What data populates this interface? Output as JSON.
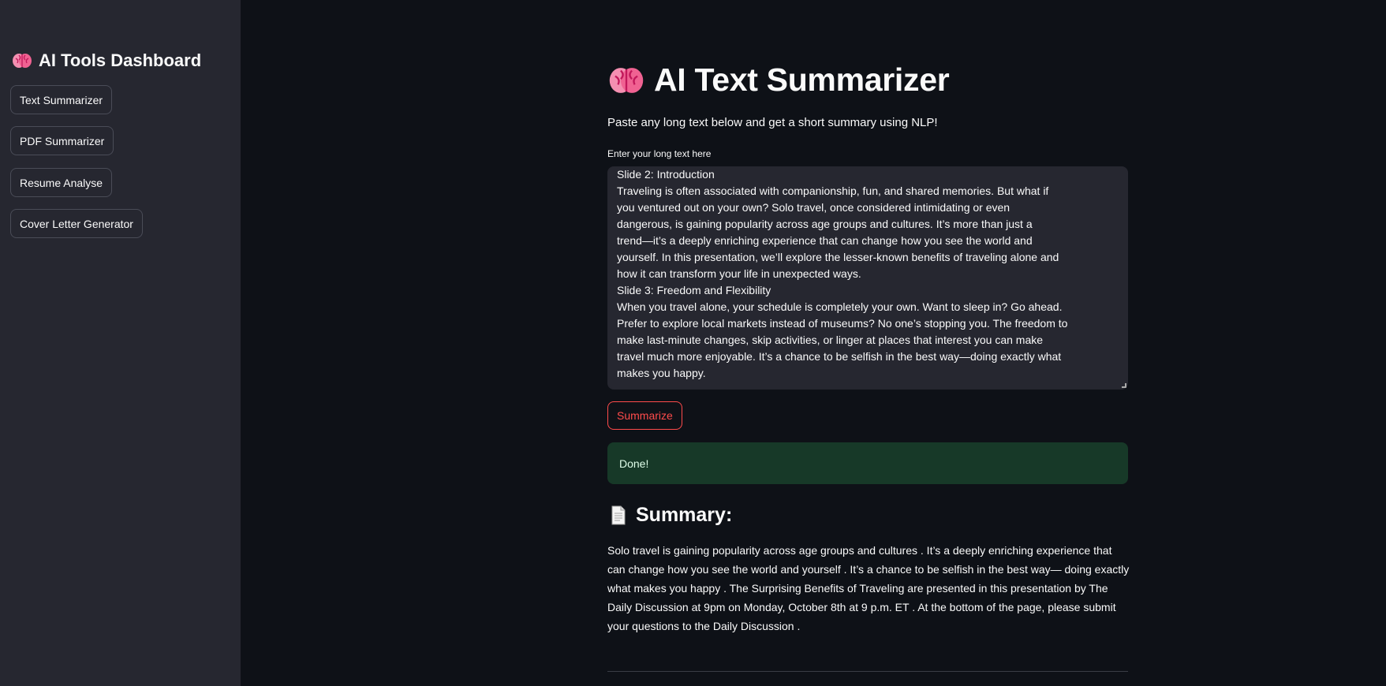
{
  "sidebar": {
    "title": "AI Tools Dashboard",
    "items": [
      {
        "label": "Text Summarizer"
      },
      {
        "label": "PDF Summarizer"
      },
      {
        "label": "Resume Analyse"
      },
      {
        "label": "Cover Letter Generator"
      }
    ]
  },
  "main": {
    "title": "AI Text Summarizer",
    "subtitle": "Paste any long text below and get a short summary using NLP!",
    "input": {
      "label": "Enter your long text here",
      "lines": [
        "Slide 2: Introduction",
        "Traveling is often associated with companionship, fun, and shared memories. But what if",
        "you ventured out on your own? Solo travel, once considered intimidating or even",
        "dangerous, is gaining popularity across age groups and cultures. It’s more than just a",
        "trend—it’s a deeply enriching experience that can change how you see the world and",
        "yourself. In this presentation, we’ll explore the lesser-known benefits of traveling alone and",
        "how it can transform your life in unexpected ways.",
        "Slide 3: Freedom and Flexibility",
        "When you travel alone, your schedule is completely your own. Want to sleep in? Go ahead.",
        "Prefer to explore local markets instead of museums? No one’s stopping you. The freedom to",
        "make last-minute changes, skip activities, or linger at places that interest you can make",
        "travel much more enjoyable. It’s a chance to be selfish in the best way—doing exactly what",
        "makes you happy."
      ]
    },
    "summarize_label": "Summarize",
    "status_message": "Done!",
    "summary": {
      "heading": "Summary:",
      "lines": [
        "Solo travel is gaining popularity across age groups and cultures . It’s a deeply enriching experience that",
        "can change how you see the world and  yourself . It’s a chance to be selfish in the best way— doing exactly",
        "what makes you happy . The Surprising Benefits of Traveling are presented in this presentation by The",
        "Daily Discussion at 9pm on Monday, October 8th at 9 p.m. ET . At the bottom of the page, please submit",
        "your questions to the Daily Discussion ."
      ]
    }
  },
  "icons": {
    "title_icon": "brain-icon",
    "summary_icon": "document-icon"
  },
  "colors": {
    "accent": "#ff4b4b",
    "success_bg": "#173928",
    "sidebar_bg": "#262730",
    "page_bg": "#0e1117"
  }
}
